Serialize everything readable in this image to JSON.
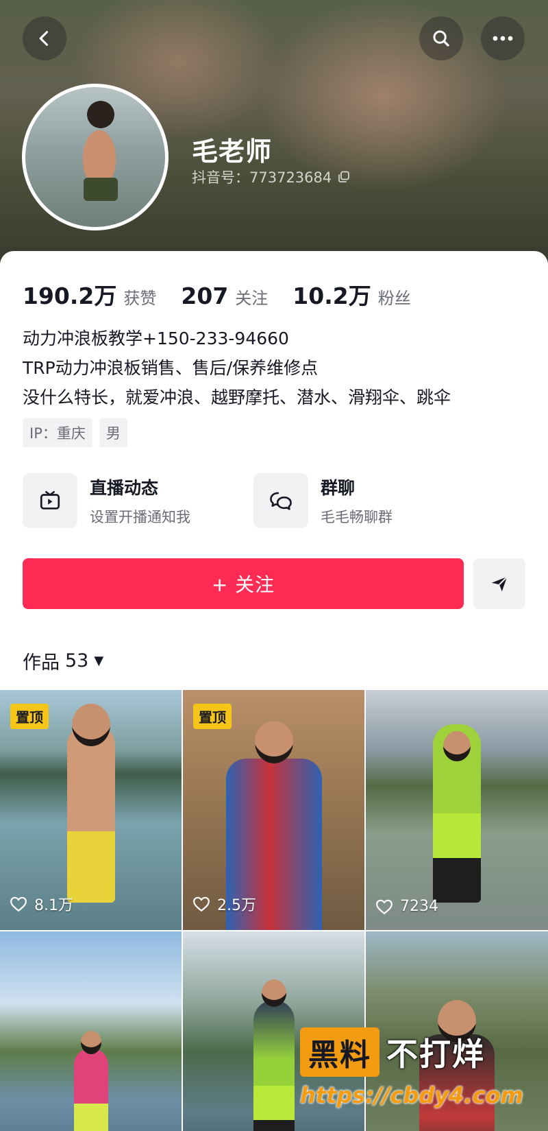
{
  "header": {
    "username": "毛老师",
    "douyin_id": "抖音号：773723684"
  },
  "stats": [
    {
      "value": "190.2万",
      "label": "获赞"
    },
    {
      "value": "207",
      "label": "关注"
    },
    {
      "value": "10.2万",
      "label": "粉丝"
    }
  ],
  "bio": [
    "动力冲浪板教学+150-233-94660",
    "TRP动力冲浪板销售、售后/保养维修点",
    "没什么特长，就爱冲浪、越野摩托、潜水、滑翔伞、跳伞"
  ],
  "tags": [
    "IP：重庆",
    "男"
  ],
  "shortcuts": {
    "live": {
      "title": "直播动态",
      "subtitle": "设置开播通知我",
      "icon": "tv-icon"
    },
    "group": {
      "title": "群聊",
      "subtitle": "毛毛畅聊群",
      "icon": "chat-bubbles-icon"
    }
  },
  "actions": {
    "follow_label": "+ 关注",
    "share_icon": "send-icon"
  },
  "works": {
    "label": "作品",
    "count": "53",
    "caret": "▼"
  },
  "grid": [
    {
      "pinned": "置顶",
      "likes": "8.1万"
    },
    {
      "pinned": "置顶",
      "likes": "2.5万"
    },
    {
      "pinned": "",
      "likes": "7234"
    },
    {
      "pinned": "",
      "likes": ""
    },
    {
      "pinned": "",
      "likes": ""
    },
    {
      "pinned": "",
      "likes": ""
    }
  ],
  "watermark": {
    "box_text": "黑料",
    "rest_text": "不打烊",
    "url": "https://cbdy4.com"
  },
  "colors": {
    "accent": "#fe2c55",
    "pin_badge": "#f5c518",
    "watermark": "#f39c12"
  }
}
